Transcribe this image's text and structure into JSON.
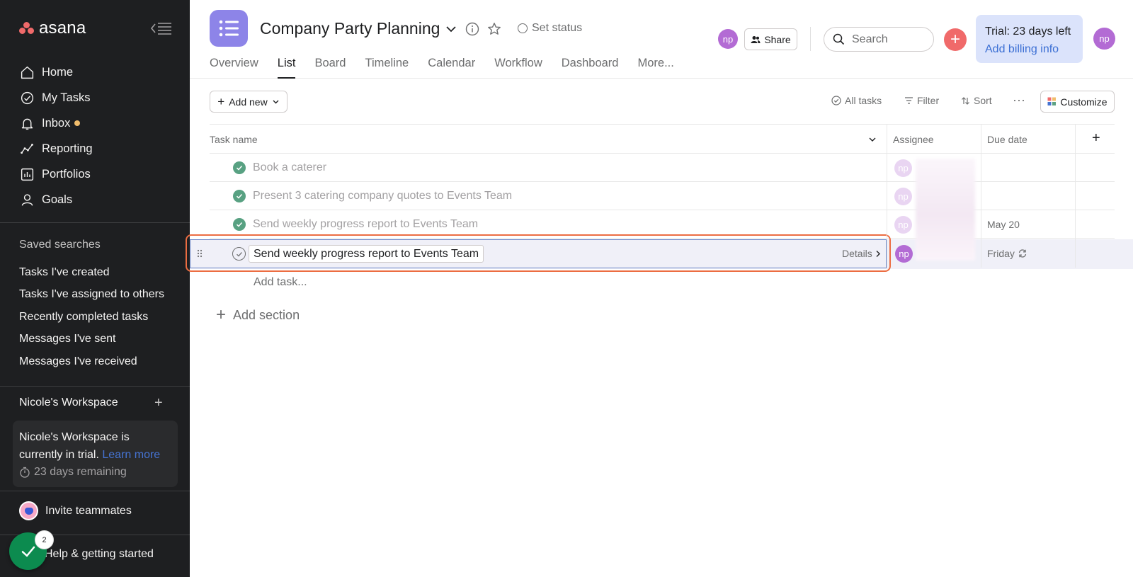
{
  "sidebar": {
    "logo_text": "asana",
    "nav": [
      {
        "label": "Home"
      },
      {
        "label": "My Tasks"
      },
      {
        "label": "Inbox"
      },
      {
        "label": "Reporting"
      },
      {
        "label": "Portfolios"
      },
      {
        "label": "Goals"
      }
    ],
    "saved_searches_title": "Saved searches",
    "saved_searches": [
      "Tasks I've created",
      "Tasks I've assigned to others",
      "Recently completed tasks",
      "Messages I've sent",
      "Messages I've received"
    ],
    "workspace_title": "Nicole's Workspace",
    "workspace_plus": "+",
    "trial_text": "Nicole's Workspace is currently in trial.",
    "trial_link": "Learn more",
    "trial_remaining": "23 days remaining",
    "invite_label": "Invite teammates",
    "help_label": "Help & getting started",
    "help_badge": "2"
  },
  "header": {
    "project_title": "Company Party Planning",
    "set_status": "Set status",
    "tabs": [
      "Overview",
      "List",
      "Board",
      "Timeline",
      "Calendar",
      "Workflow",
      "Dashboard",
      "More..."
    ],
    "active_tab": "List",
    "member_initials": "np",
    "share_label": "Share",
    "search_placeholder": "Search",
    "add_symbol": "+",
    "trial_title": "Trial: 23 days left",
    "trial_link": "Add billing info",
    "user_initials": "np"
  },
  "toolbar": {
    "add_new": "Add new",
    "all_tasks": "All tasks",
    "filter": "Filter",
    "sort": "Sort",
    "more": "···",
    "customize": "Customize"
  },
  "table": {
    "columns": [
      "Task name",
      "Assignee",
      "Due date"
    ],
    "add_column": "+",
    "rows": [
      {
        "name": "Book a caterer",
        "assignee": "np",
        "due": "",
        "completed": true
      },
      {
        "name": "Present 3 catering company quotes to Events Team",
        "assignee": "np",
        "due": "",
        "completed": true
      },
      {
        "name": "Send weekly progress report to Events Team",
        "assignee": "np",
        "due": "May 20",
        "completed": true
      }
    ],
    "active_row": {
      "name": "Send weekly progress report to Events Team",
      "details": "Details",
      "assignee": "np",
      "due": "Friday"
    },
    "add_task": "Add task...",
    "add_section": "Add section"
  },
  "colors": {
    "sidebar_bg": "#1e1f21",
    "accent_red": "#f06a6a",
    "project_icon": "#8d84e8",
    "avatar": "#b36bd4",
    "complete_green": "#58a182",
    "highlight": "#ec6d42"
  }
}
